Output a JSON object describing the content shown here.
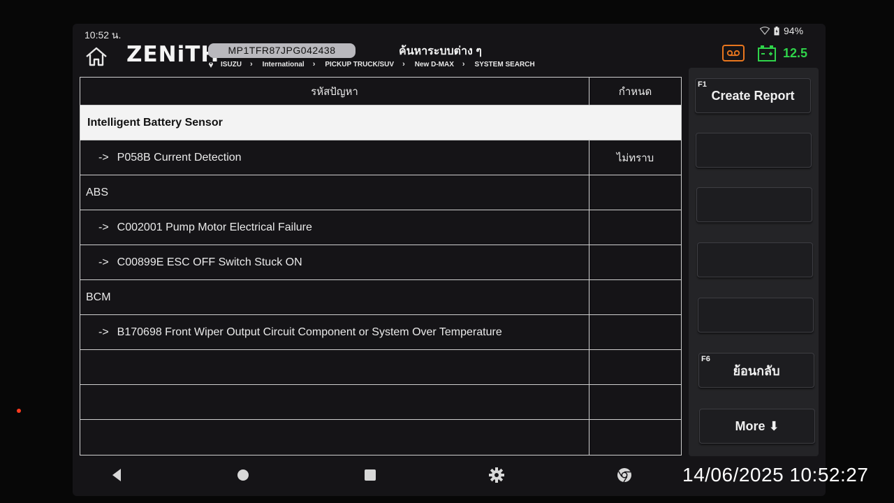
{
  "status_bar": {
    "time": "10:52 น.",
    "battery": "94%"
  },
  "header": {
    "logo": "ZENiTH",
    "vin": "MP1TFR87JPG042438",
    "title": "ค้นหาระบบต่าง ๆ",
    "breadcrumb": [
      "ISUZU",
      "International",
      "PICKUP TRUCK/SUV",
      "New D-MAX",
      "SYSTEM SEARCH"
    ],
    "voltage": "12.5"
  },
  "table": {
    "columns": [
      "รหัสปัญหา",
      "กำหนด"
    ],
    "rows": [
      {
        "type": "selected",
        "code": "Intelligent Battery Sensor",
        "definition": ""
      },
      {
        "type": "item",
        "arrow": "->",
        "code": "P058B Current Detection",
        "definition": "ไม่ทราบ"
      },
      {
        "type": "group",
        "code": "ABS",
        "definition": ""
      },
      {
        "type": "item",
        "arrow": "->",
        "code": "C002001 Pump Motor Electrical Failure",
        "definition": ""
      },
      {
        "type": "item",
        "arrow": "->",
        "code": "C00899E ESC OFF Switch Stuck ON",
        "definition": ""
      },
      {
        "type": "group",
        "code": "BCM",
        "definition": ""
      },
      {
        "type": "item",
        "arrow": "->",
        "code": "B170698 Front Wiper Output Circuit Component or System Over Temperature",
        "definition": ""
      },
      {
        "type": "empty",
        "code": "",
        "definition": ""
      },
      {
        "type": "empty",
        "code": "",
        "definition": ""
      },
      {
        "type": "empty",
        "code": "",
        "definition": ""
      }
    ]
  },
  "side_panel": {
    "buttons": [
      {
        "fkey": "F1",
        "label": "Create Report"
      },
      {
        "fkey": "",
        "label": ""
      },
      {
        "fkey": "",
        "label": ""
      },
      {
        "fkey": "",
        "label": ""
      },
      {
        "fkey": "",
        "label": ""
      },
      {
        "fkey": "F6",
        "label": "ย้อนกลับ"
      },
      {
        "fkey": "",
        "label": "More ⬇"
      }
    ]
  },
  "photo_timestamp": "14/06/2025 10:52:27",
  "colors": {
    "voltage": "#2fd34a",
    "record_icon": "#e8761e",
    "battery_icon": "#2fd34a"
  }
}
